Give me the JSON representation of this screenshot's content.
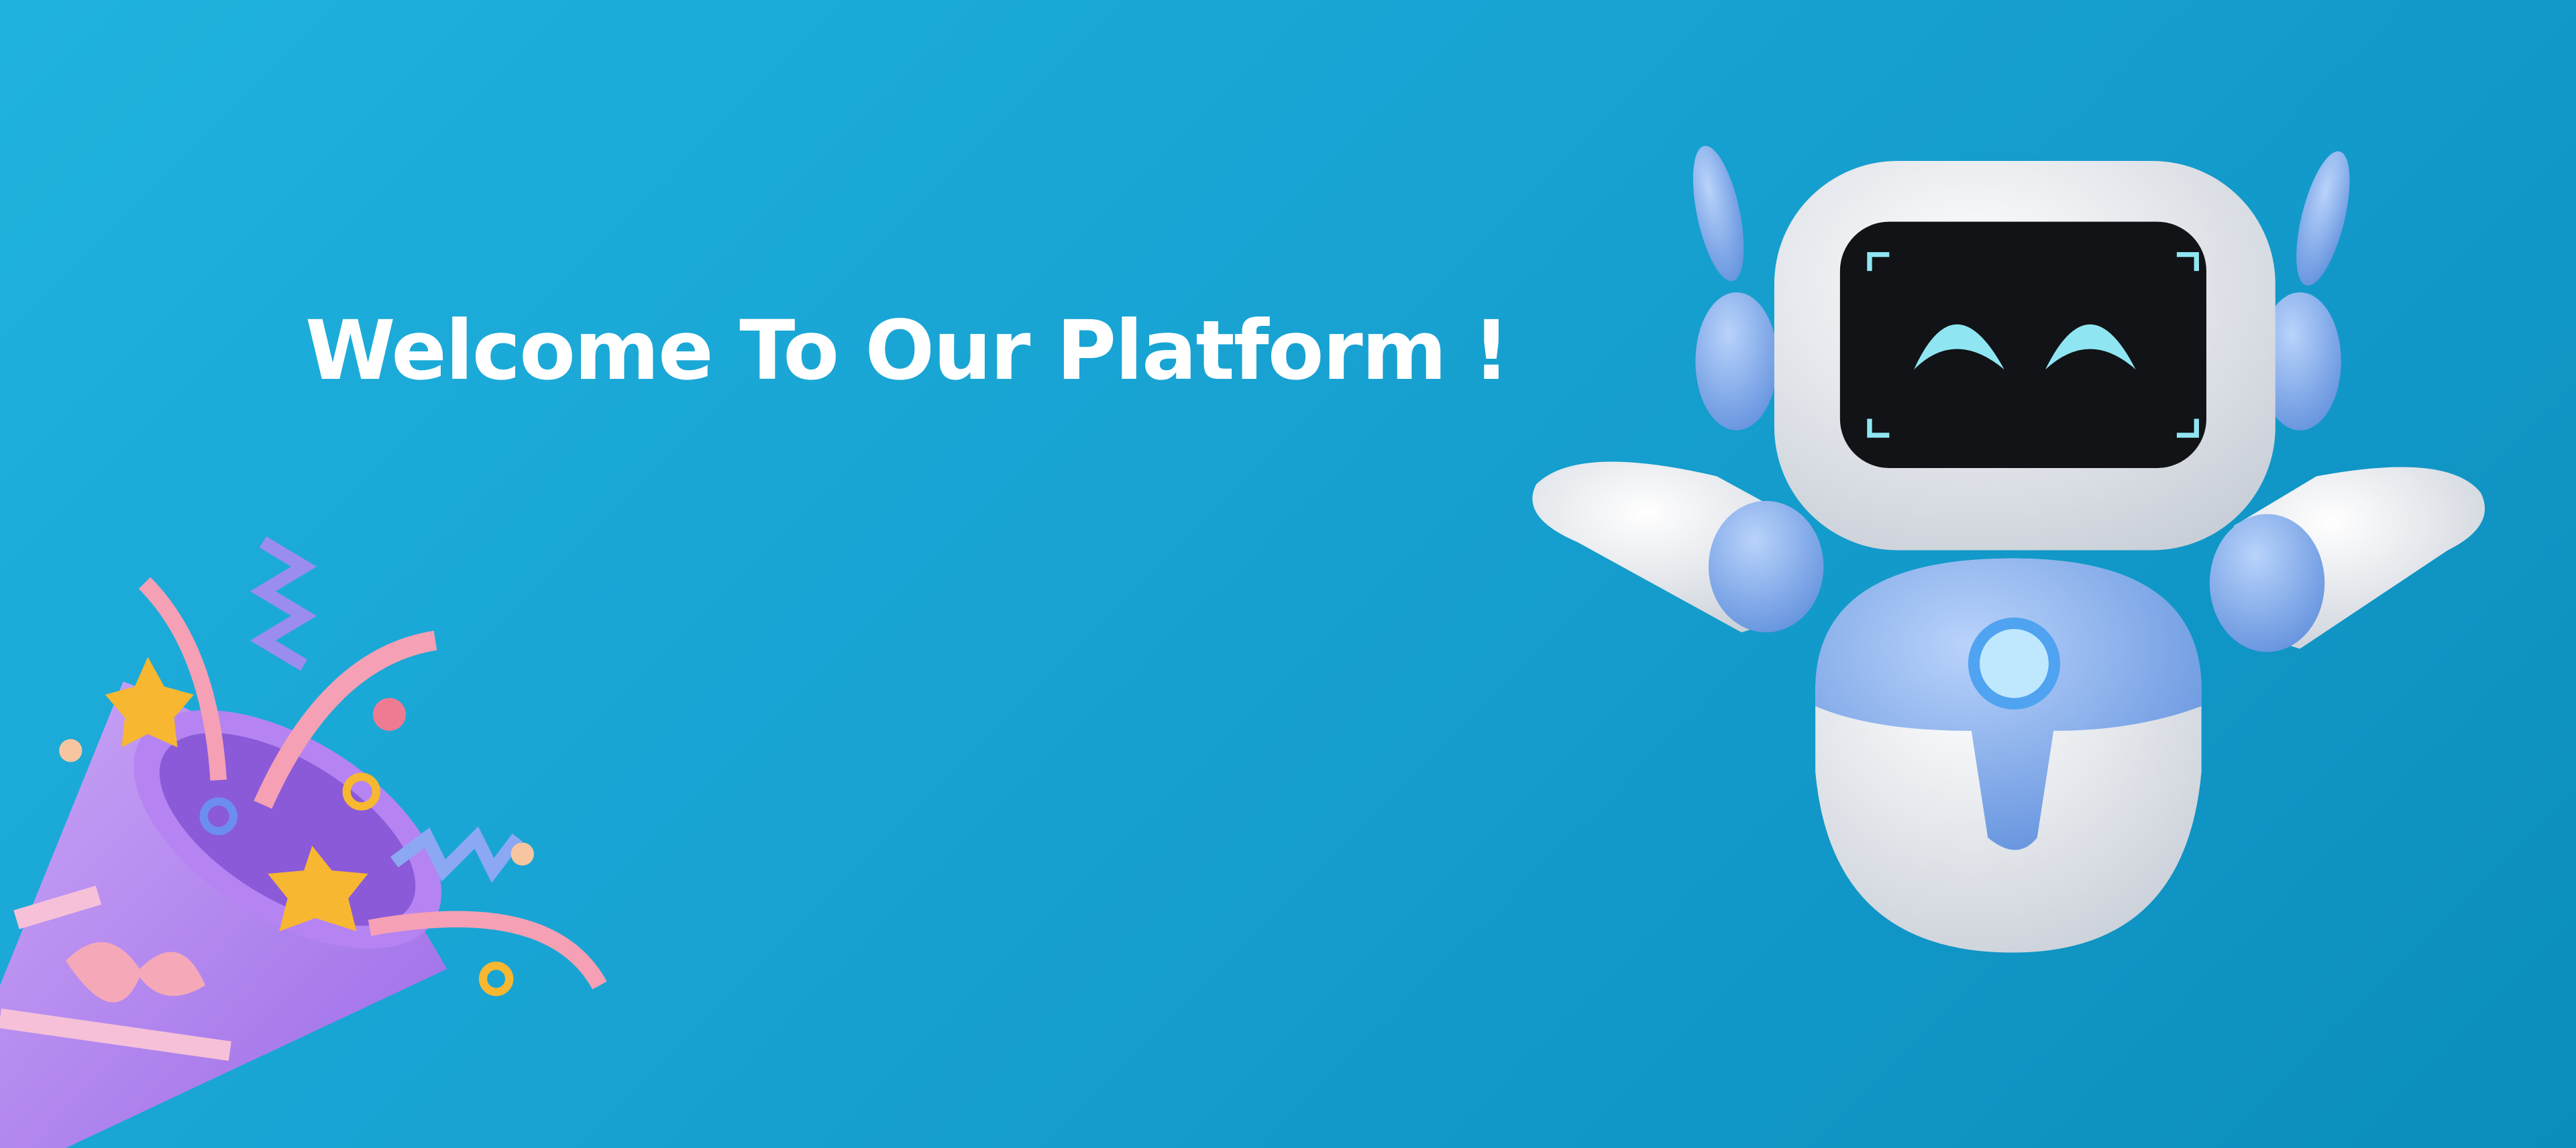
{
  "banner": {
    "heading": "Welcome To Our Platform !",
    "background_colors": [
      "#20b2de",
      "#0b8dbd"
    ],
    "illustrations": [
      "party-popper",
      "robot"
    ]
  }
}
